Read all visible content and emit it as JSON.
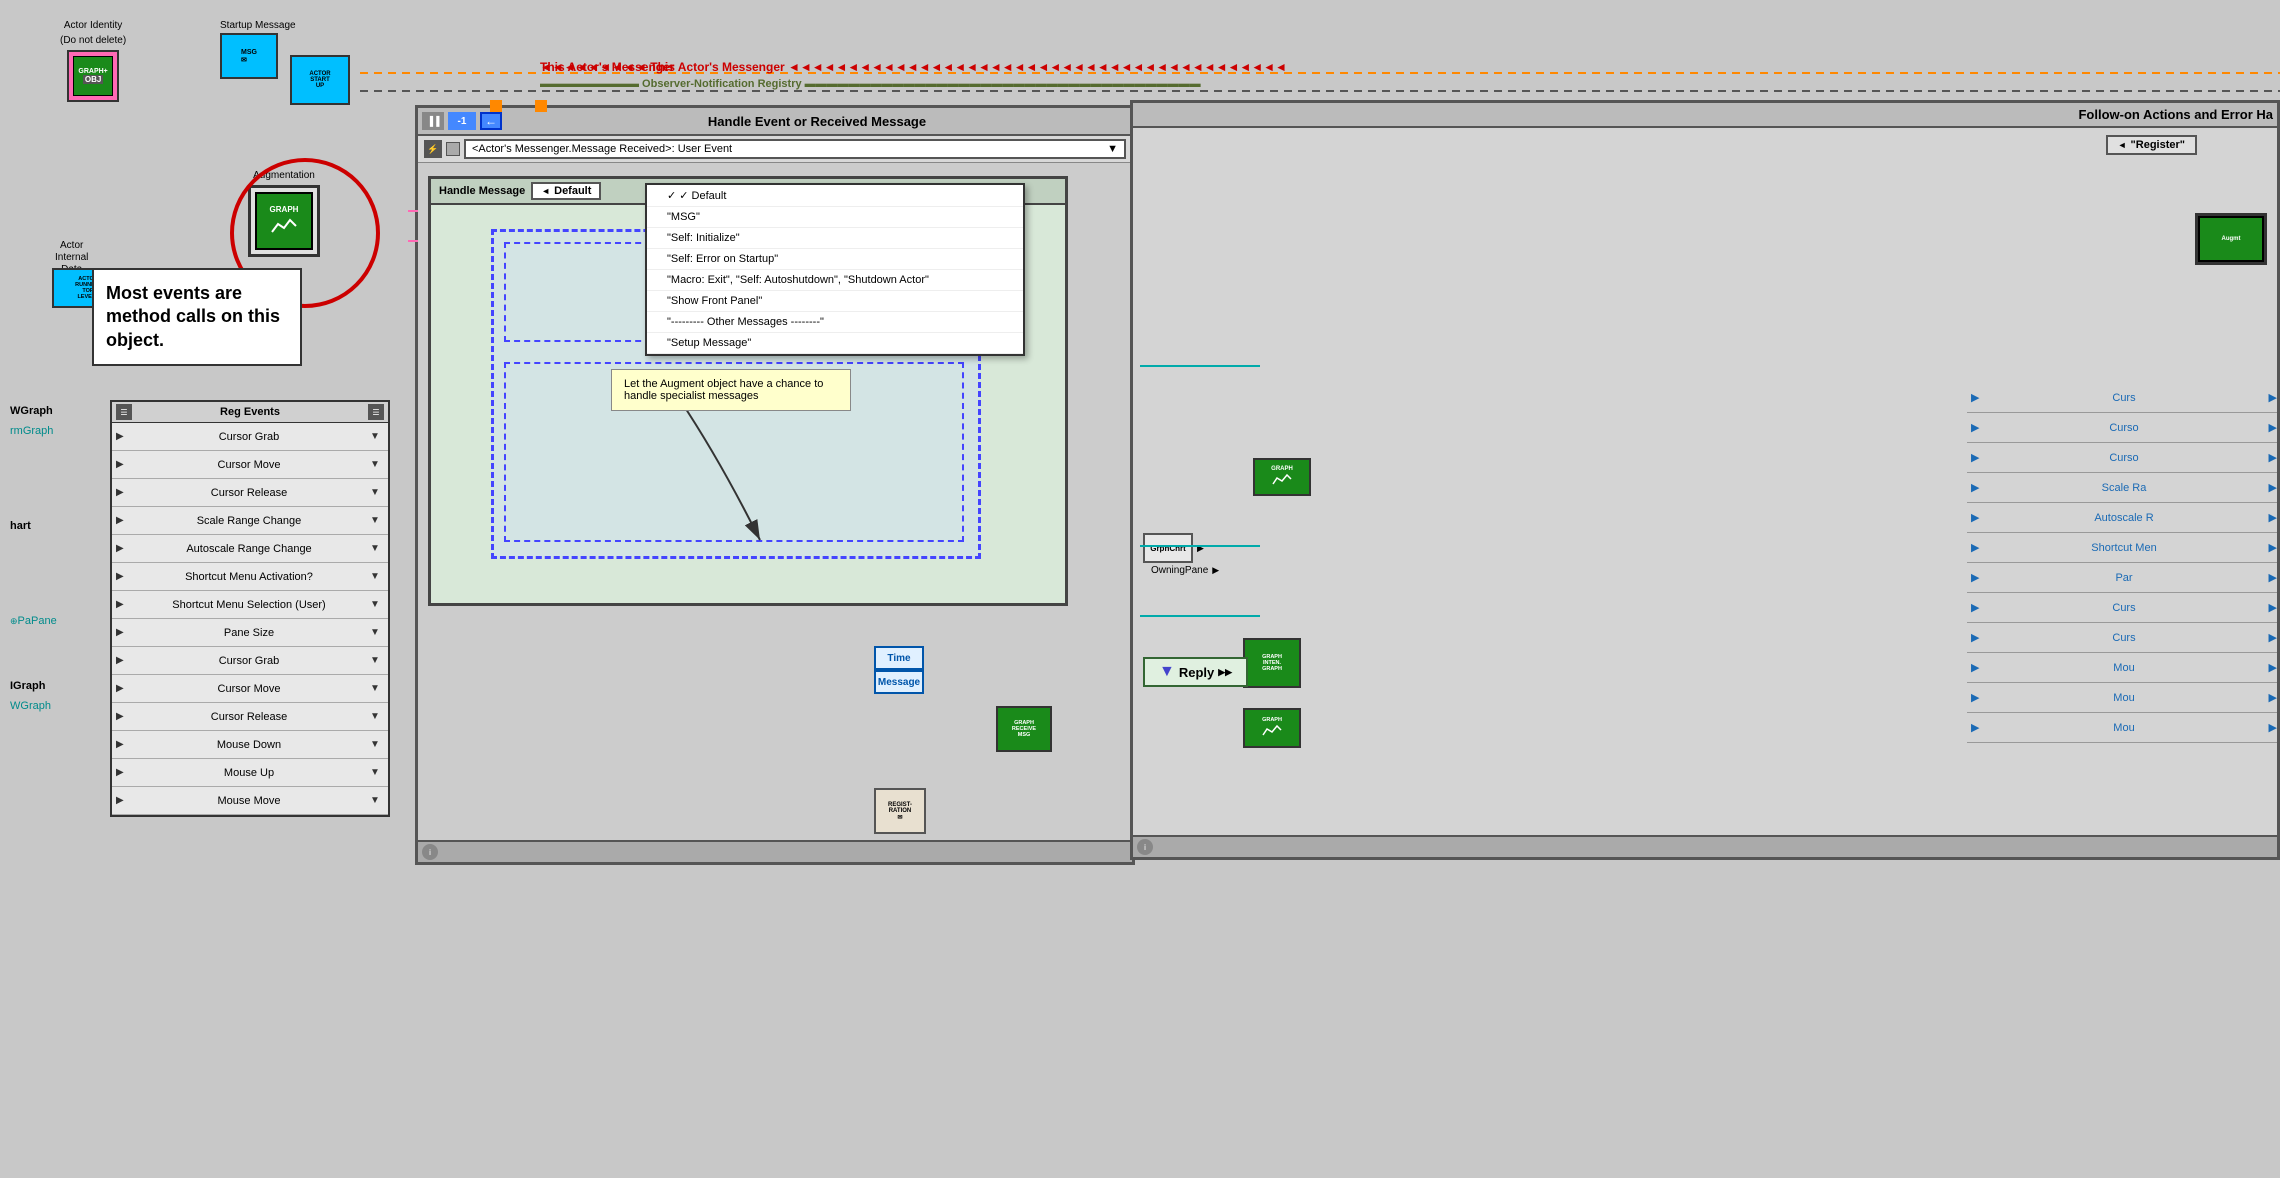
{
  "actorIdentity": {
    "label1": "Actor Identity",
    "label2": "(Do not delete)",
    "viText": "GRAPH+\nOBJ"
  },
  "startupMessage": {
    "label": "Startup Message",
    "msgText": "MSG",
    "actorText": "ACTOR\nSTART\nUP"
  },
  "augmentation": {
    "label": "Augmentation",
    "viText": "GRAPH"
  },
  "actorInternal": {
    "label1": "Actor",
    "label2": "Internal",
    "label3": "Data",
    "viText": "ACTOR\nRUNNING\nTOP\nLEVEL?"
  },
  "annotationText": "Most events are method calls on this object.",
  "wires": {
    "topOrangeLabel": "This Actor's Messenger",
    "topObserverLabel": "Observer-Notification Registry"
  },
  "regEvents": {
    "title": "Reg Events",
    "events": [
      "Cursor Grab",
      "Cursor Move",
      "Cursor Release",
      "Scale Range Change",
      "Autoscale Range Change",
      "Shortcut Menu Activation?",
      "Shortcut Menu Selection (User)",
      "Pane Size",
      "Cursor Grab",
      "Cursor Move",
      "Cursor Release",
      "Mouse Down",
      "Mouse Up",
      "Mouse Move"
    ]
  },
  "handleEvent": {
    "frameTitle": "Handle Event or Received Message",
    "eventSelector": "<Actor's Messenger.Message Received>: User Event",
    "handleMsgTitle": "Handle Message",
    "defaultLabel": "Default"
  },
  "dropdownMenu": {
    "items": [
      {
        "text": "Default",
        "checked": true
      },
      {
        "text": "\"MSG\"",
        "checked": false
      },
      {
        "text": "\"Self: Initialize\"",
        "checked": false
      },
      {
        "text": "\"Self: Error on Startup\"",
        "checked": false
      },
      {
        "text": "\"Macro: Exit\", \"Self: Autoshutdown\", \"Shutdown Actor\"",
        "checked": false
      },
      {
        "text": "\"Show Front Panel\"",
        "checked": false
      },
      {
        "text": "\"--------- Other Messages --------\"",
        "checked": false
      },
      {
        "text": "\"Setup Message\"",
        "checked": false
      }
    ]
  },
  "tooltip": {
    "text": "Let the Augment object have a chance to handle specialist messages"
  },
  "timeMessage": {
    "time": "Time",
    "message": "Message"
  },
  "registrationBox": {
    "text": "REGIST-\nRATION"
  },
  "followOn": {
    "headerText": "Follow-on Actions and Error Ha",
    "registerLabel": "\"Register\""
  },
  "reply": {
    "label": "Reply"
  },
  "rightEventList": {
    "items": [
      "Curs",
      "Curso",
      "Curso",
      "Scale Ra",
      "Autoscale R",
      "Shortcut Men",
      "Par",
      "Curs",
      "Curs",
      "Mou",
      "Mou",
      "Mou"
    ]
  },
  "graphNodes": {
    "receive": "GRAPH\nRECEIVE\nMSG",
    "graph1": "GRAPH",
    "graph2": "GRAPH\nINTEN.\nGRAPH",
    "graph3": "GRAPH",
    "grphChrt": "GrphChrt",
    "owningPane": "OwningPane"
  },
  "wgraphLabel": "WGraph",
  "formGraphLabel": "rmGraph",
  "chartLabel": "hart",
  "paneLabel": "PaPane",
  "igraphLabel": "IGraph",
  "wgraph2Label": "WGraph",
  "counterValue": "-1",
  "minus1": "-1"
}
